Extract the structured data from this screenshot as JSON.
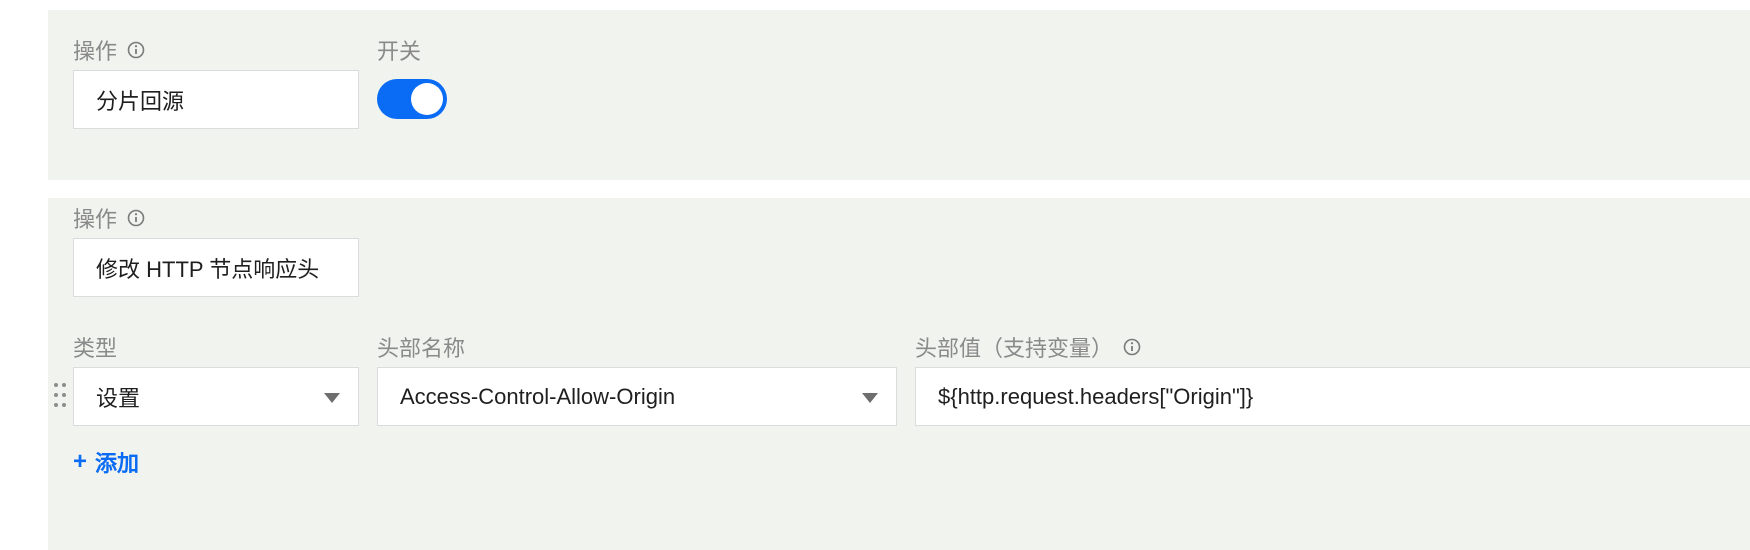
{
  "rule1": {
    "operation_label": "操作",
    "operation_value": "分片回源",
    "switch_label": "开关",
    "switch_on": true
  },
  "rule2": {
    "operation_label": "操作",
    "operation_value": "修改 HTTP 节点响应头",
    "type_label": "类型",
    "type_value": "设置",
    "header_name_label": "头部名称",
    "header_name_value": "Access-Control-Allow-Origin",
    "header_value_label": "头部值（支持变量）",
    "header_value_value": "${http.request.headers[\"Origin\"]}",
    "add_plus": "+",
    "add_label": "添加"
  },
  "icons": {
    "info": "info-circle-icon",
    "caret": "caret-down-icon",
    "drag": "drag-handle-icon"
  },
  "colors": {
    "panel_bg": "#f1f3ee",
    "accent": "#0a6cf5",
    "label": "#8a8a8a"
  }
}
